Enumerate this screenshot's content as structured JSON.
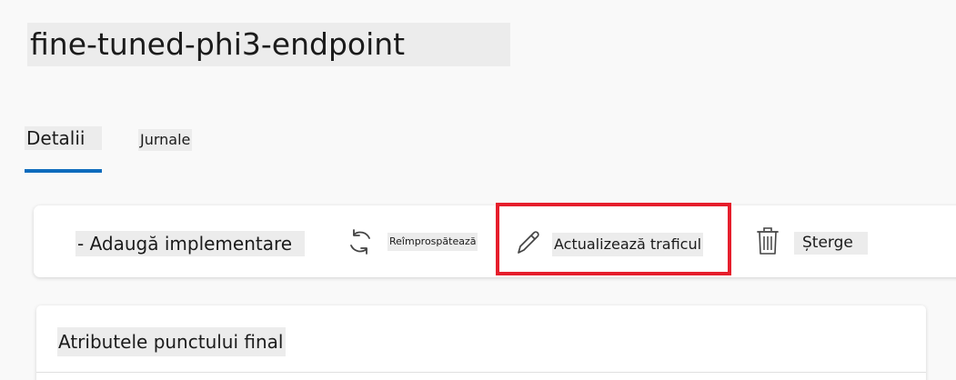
{
  "header": {
    "title": "fine-tuned-phi3-endpoint"
  },
  "tabs": [
    {
      "label": "Detalii",
      "selected": true
    },
    {
      "label": "Jurnale",
      "selected": false
    }
  ],
  "toolbar": {
    "add_label": "- Adaugă implementare",
    "refresh_label": "Reîmprospătează",
    "refresh_icon": "refresh-icon",
    "update_traffic_label": "Actualizează traficul",
    "update_traffic_icon": "pencil-icon",
    "delete_label": "Șterge",
    "delete_icon": "trash-icon",
    "highlight_color": "#e61e2c"
  },
  "card": {
    "title": "Atributele punctului final"
  },
  "colors": {
    "accent": "#0f6cbd",
    "highlight": "#e61e2c"
  }
}
